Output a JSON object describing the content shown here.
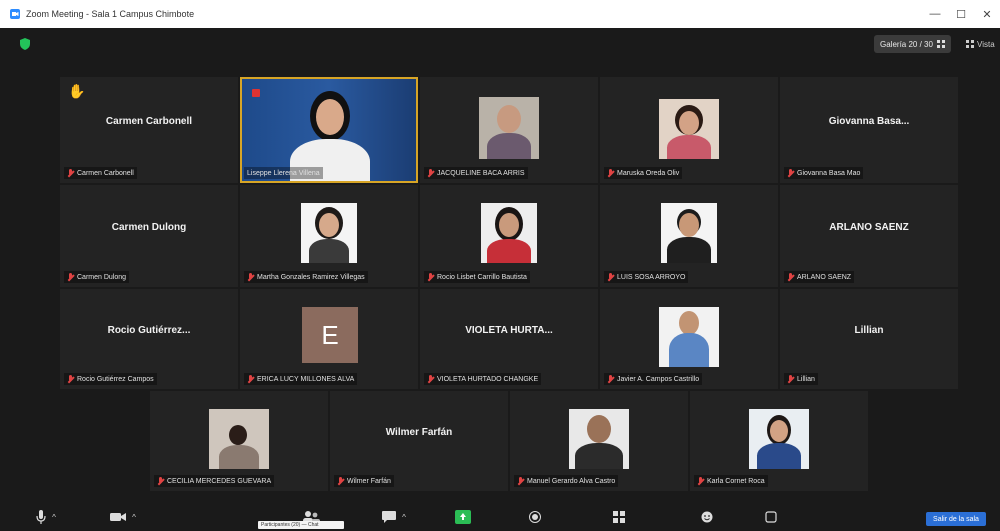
{
  "window": {
    "title": "Zoom Meeting - Sala 1 Campus Chimbote"
  },
  "header": {
    "view_label": "Galería 20 / 30",
    "view_mode": "Vista"
  },
  "tiles": [
    {
      "center": "Carmen Carbonell",
      "plate": "Carmen Carbonell"
    },
    {
      "center": "",
      "plate": "Liseppe Llerena Villena"
    },
    {
      "center": "",
      "plate": "JACQUELINE BACA ARRIS"
    },
    {
      "center": "",
      "plate": "Maruska Oreda Oliv"
    },
    {
      "center": "Giovanna Basa...",
      "plate": "Giovanna Basa Mao"
    },
    {
      "center": "Carmen Dulong",
      "plate": "Carmen Dulong"
    },
    {
      "center": "",
      "plate": "Martha Gonzales Ramirez Villegas"
    },
    {
      "center": "",
      "plate": "Rocio Lisbet Carrillo Bautista"
    },
    {
      "center": "",
      "plate": "LUIS SOSA ARROYO"
    },
    {
      "center": "ARLANO SAENZ",
      "plate": "ARLANO SAENZ"
    },
    {
      "center": "Rocio Gutiérrez...",
      "plate": "Rocio Gutiérrez Campos"
    },
    {
      "center": "",
      "plate": "ERICA LUCY MILLONES ALVA",
      "avatar_letter": "E"
    },
    {
      "center": "VIOLETA HURTA...",
      "plate": "VIOLETA HURTADO CHANGKE"
    },
    {
      "center": "",
      "plate": "Javier A. Campos Castrillo"
    },
    {
      "center": "Lillian",
      "plate": "Lillian"
    },
    {
      "center": "",
      "plate": "CECILIA MERCEDES GUEVARA"
    },
    {
      "center": "Wilmer Farfán",
      "plate": "Wilmer Farfán"
    },
    {
      "center": "",
      "plate": "Manuel Gerardo Alva Castro"
    },
    {
      "center": "",
      "plate": "Karla Cornet Roca"
    }
  ],
  "toolbar": {
    "leave_label": "Salir de la sala",
    "tooltip": "Participantes (20) — Chat"
  },
  "icons": [
    "microphone-icon",
    "camera-icon",
    "participants-icon",
    "chat-icon",
    "share-screen-icon",
    "record-icon",
    "reactions-icon",
    "apps-icon",
    "whiteboard-icon",
    "more-icon"
  ]
}
